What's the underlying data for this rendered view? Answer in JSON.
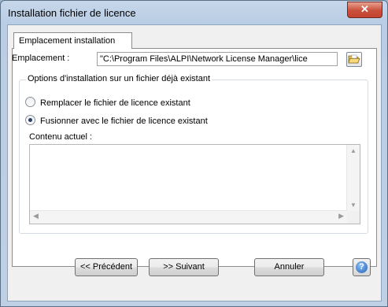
{
  "window": {
    "title": "Installation fichier de licence",
    "close_glyph": "✕"
  },
  "tabs": [
    {
      "label": "Emplacement installation"
    }
  ],
  "location": {
    "label": "Emplacement :",
    "value": "\"C:\\Program Files\\ALPI\\Network License Manager\\lice",
    "browse_icon": "folder-open-icon"
  },
  "options": {
    "legend": "Options d'installation sur un fichier déjà existant",
    "replace_label": "Remplacer le fichier de licence existant",
    "replace_selected": false,
    "merge_label": "Fusionner avec le fichier de licence existant",
    "merge_selected": true
  },
  "current_content": {
    "label": "Contenu actuel :",
    "value": ""
  },
  "buttons": {
    "previous": "<< Précédent",
    "next": ">> Suivant",
    "cancel": "Annuler",
    "help_icon": "help-icon"
  },
  "colors": {
    "close_button": "#c9503c",
    "title_bar": "#bfd0e5",
    "dialog_bg": "#f0f0f0"
  }
}
